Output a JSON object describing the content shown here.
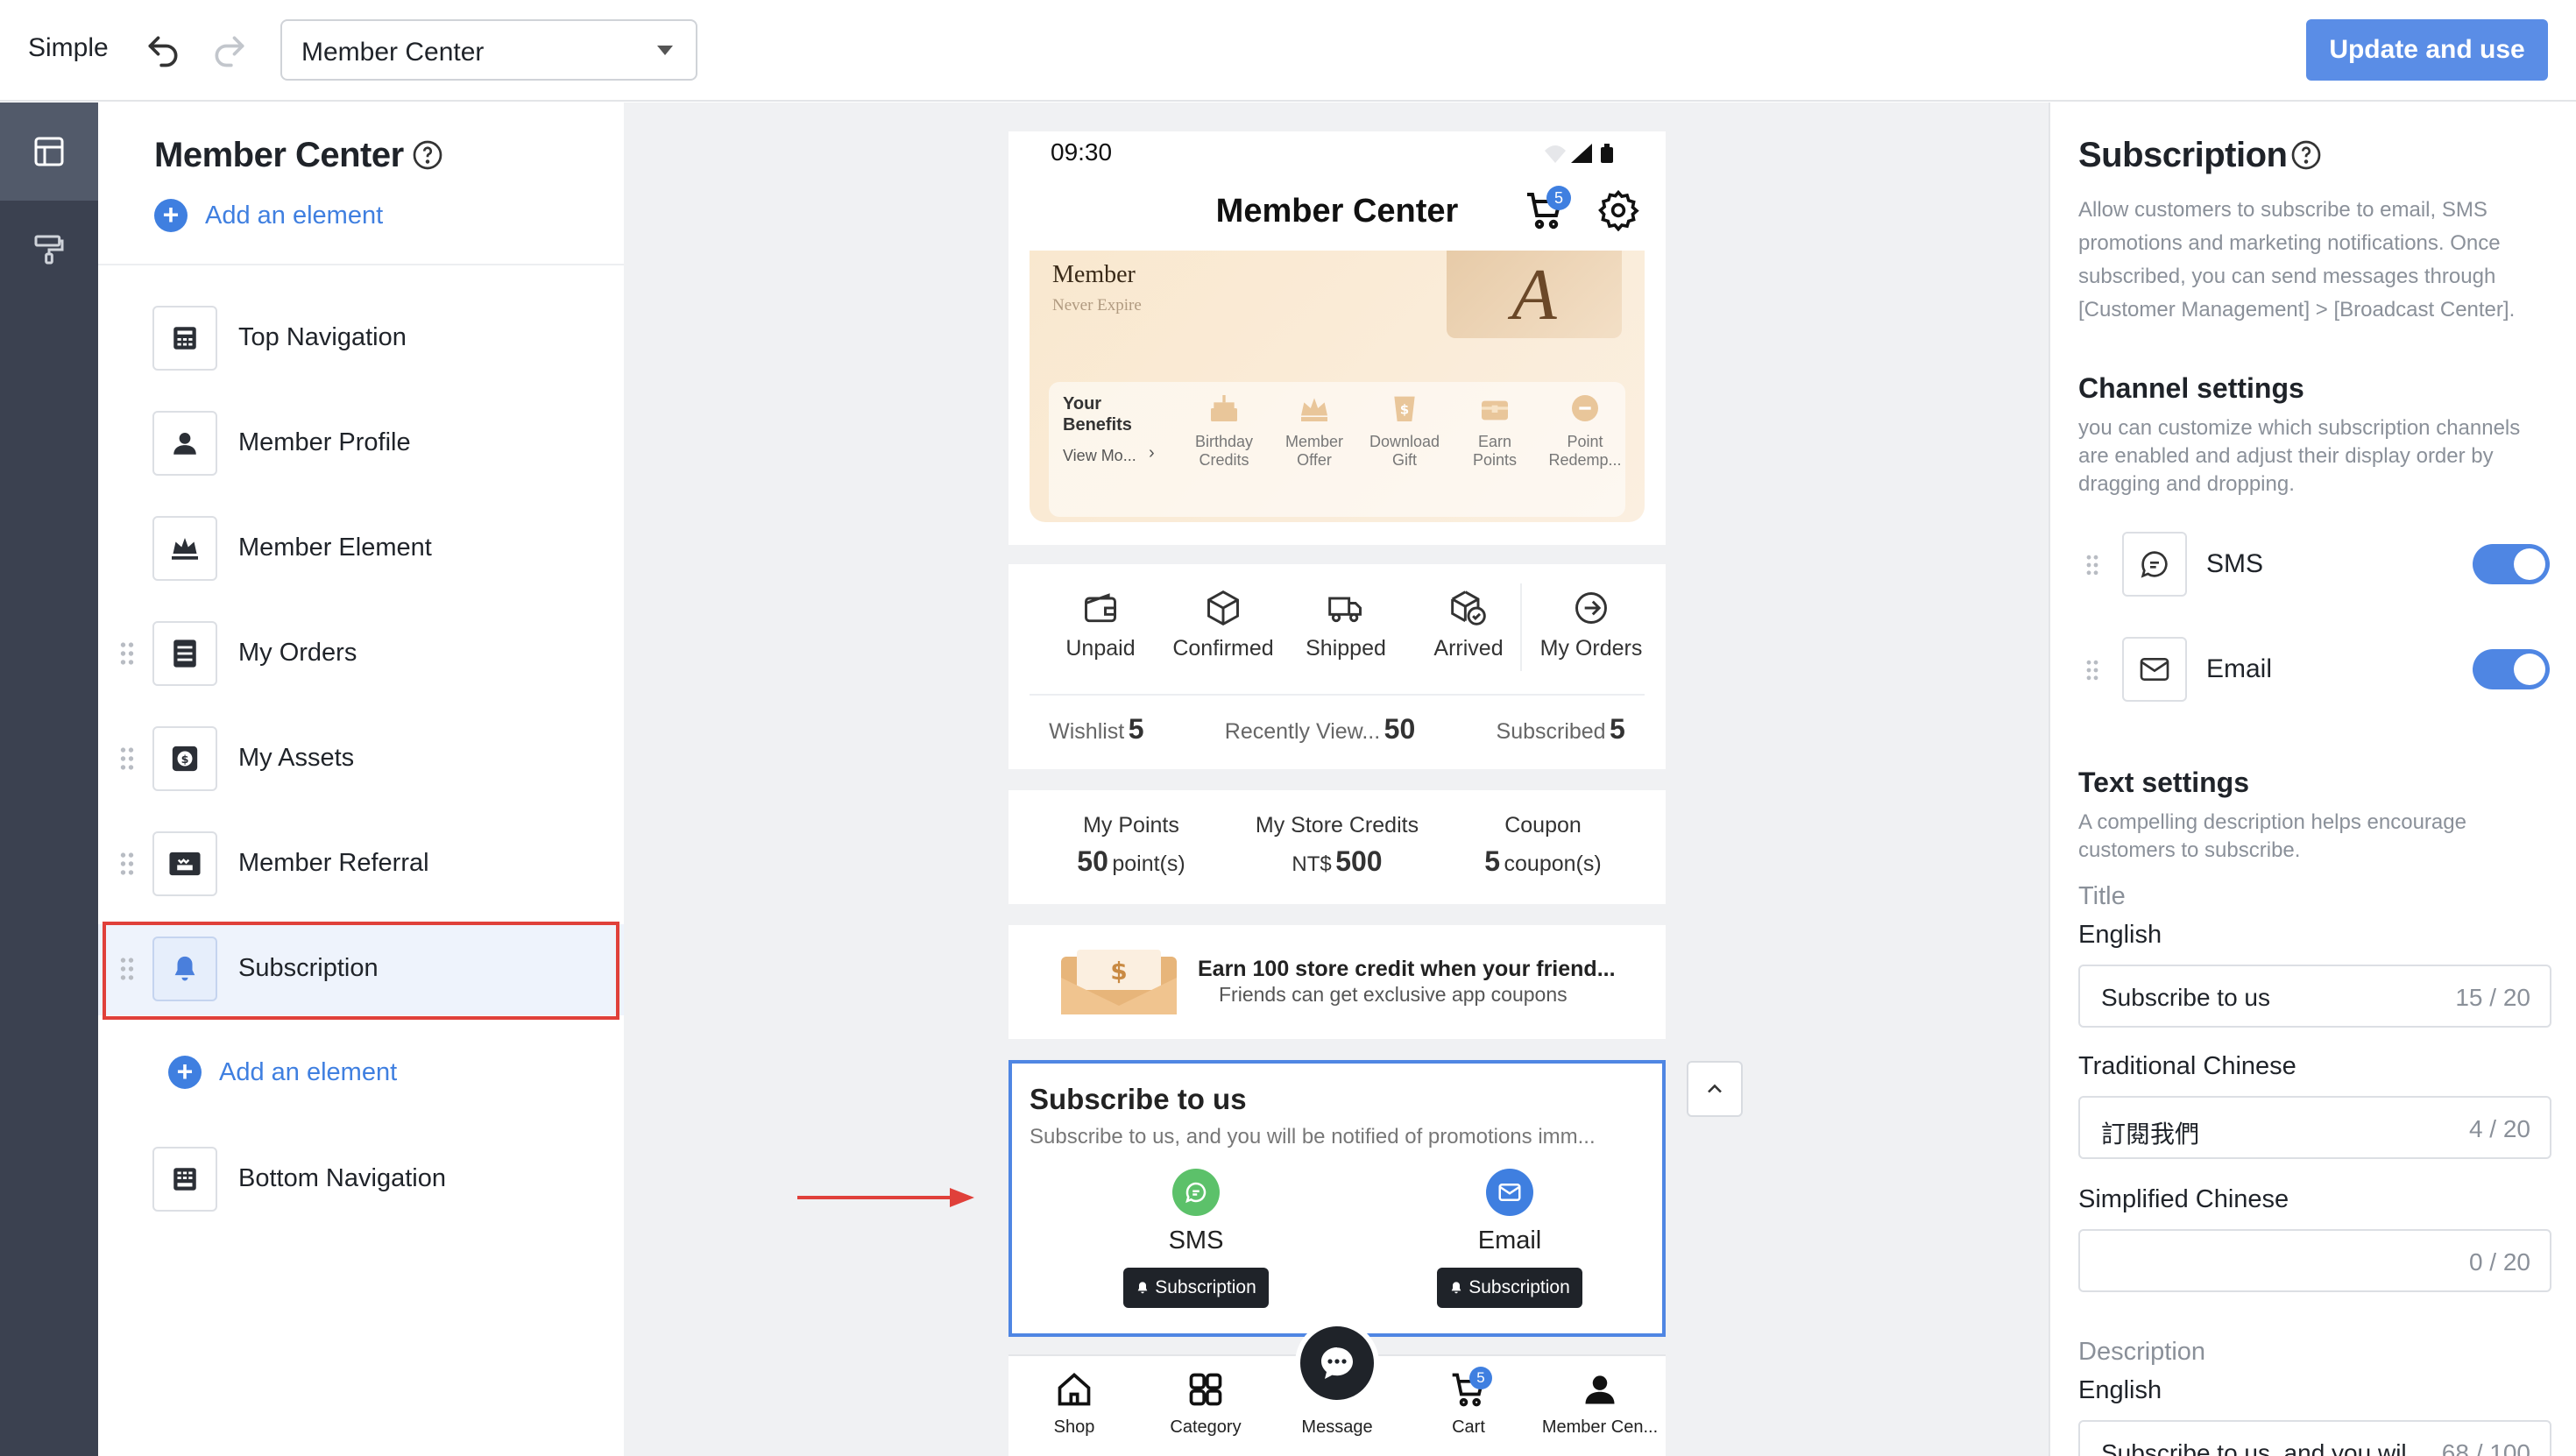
{
  "header": {
    "mode": "Simple",
    "page_select": "Member Center",
    "update_button": "Update and use"
  },
  "element_list": {
    "title": "Member Center",
    "add_element": "Add an element",
    "items": [
      {
        "label": "Top Navigation",
        "icon": "top-navigation-icon"
      },
      {
        "label": "Member Profile",
        "icon": "member-profile-icon"
      },
      {
        "label": "Member Element",
        "icon": "crown-icon"
      },
      {
        "label": "My Orders",
        "icon": "orders-icon"
      },
      {
        "label": "My Assets",
        "icon": "assets-icon"
      },
      {
        "label": "Member Referral",
        "icon": "referral-icon"
      },
      {
        "label": "Subscription",
        "icon": "bell-icon"
      },
      {
        "label": "Bottom Navigation",
        "icon": "bottom-navigation-icon"
      }
    ]
  },
  "phone": {
    "status_time": "09:30",
    "title": "Member Center",
    "cart_badge": "5",
    "card": {
      "name": "Member",
      "expiry": "Never Expire",
      "benefits_title_1": "Your",
      "benefits_title_2": "Benefits",
      "view_more": "View Mo...",
      "benefits": [
        {
          "l1": "Birthday",
          "l2": "Credits"
        },
        {
          "l1": "Member",
          "l2": "Offer"
        },
        {
          "l1": "Download",
          "l2": "Gift"
        },
        {
          "l1": "Earn",
          "l2": "Points"
        },
        {
          "l1": "Point",
          "l2": "Redemp..."
        }
      ]
    },
    "orders": {
      "statuses": [
        "Unpaid",
        "Confirmed",
        "Shipped",
        "Arrived"
      ],
      "my_orders": "My Orders",
      "wishlist_label": "Wishlist",
      "wishlist_count": "5",
      "recent_label": "Recently View...",
      "recent_count": "50",
      "subscribed_label": "Subscribed",
      "subscribed_count": "5"
    },
    "assets": {
      "points_label": "My Points",
      "points_value": "50",
      "points_unit": "point(s)",
      "credits_label": "My Store Credits",
      "credits_currency": "NT$",
      "credits_value": "500",
      "coupon_label": "Coupon",
      "coupon_value": "5",
      "coupon_unit": "coupon(s)"
    },
    "referral": {
      "title": "Earn 100 store credit when your friend...",
      "subtitle": "Friends can get exclusive app coupons"
    },
    "subscribe": {
      "title": "Subscribe to us",
      "desc": "Subscribe to us, and you will be notified of promotions imm...",
      "sms": "SMS",
      "email": "Email",
      "button": "Subscription",
      "sms_color": "#5cc16a",
      "email_color": "#3f7fe0"
    },
    "bottom_nav": {
      "items": [
        "Shop",
        "Category",
        "Message",
        "Cart",
        "Member Cen..."
      ],
      "cart_badge": "5"
    }
  },
  "settings": {
    "title": "Subscription",
    "intro": "Allow customers to subscribe to email, SMS promotions and marketing notifications. Once subscribed, you can send messages through [Customer Management] > [Broadcast Center].",
    "channel_title": "Channel settings",
    "channel_desc": "you can customize which subscription channels are enabled and adjust their display order by dragging and dropping.",
    "channels": [
      {
        "label": "SMS",
        "enabled": true
      },
      {
        "label": "Email",
        "enabled": true
      }
    ],
    "text_title": "Text settings",
    "text_desc": "A compelling description helps encourage customers to subscribe.",
    "title_label": "Title",
    "fields": [
      {
        "lang": "English",
        "value": "Subscribe to us",
        "count": "15 / 20"
      },
      {
        "lang": "Traditional Chinese",
        "value": "訂閱我們",
        "count": "4 / 20"
      },
      {
        "lang": "Simplified Chinese",
        "value": "",
        "count": "0 / 20"
      }
    ],
    "description_label": "Description",
    "desc_field": {
      "lang": "English",
      "value": "Subscribe to us, and you wil",
      "count": "68 / 100"
    }
  },
  "colors": {
    "accent": "#3f7fe0",
    "primary_button": "#5a8de6",
    "selection_red": "#e0403a",
    "rail": "#3b4150"
  }
}
